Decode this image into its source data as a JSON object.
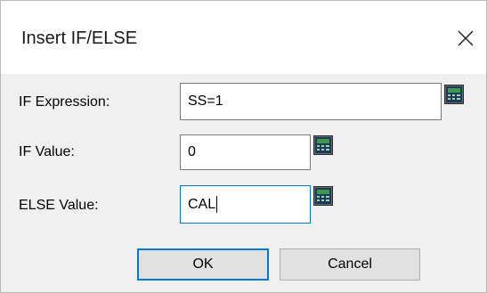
{
  "dialog": {
    "title": "Insert IF/ELSE",
    "close_glyph": "✕"
  },
  "fields": {
    "if_expression": {
      "label": "IF Expression:",
      "value": "SS=1"
    },
    "if_value": {
      "label": "IF Value:",
      "value": "0"
    },
    "else_value": {
      "label": "ELSE Value:",
      "value": "CAL"
    }
  },
  "buttons": {
    "ok_label": "OK",
    "cancel_label": "Cancel"
  },
  "icons": {
    "calculator": "calculator-icon",
    "close": "close-icon"
  },
  "colors": {
    "focus_accent": "#0078d7",
    "calculator_screen": "#3c9a4a",
    "calculator_body": "#1b3a5c"
  }
}
